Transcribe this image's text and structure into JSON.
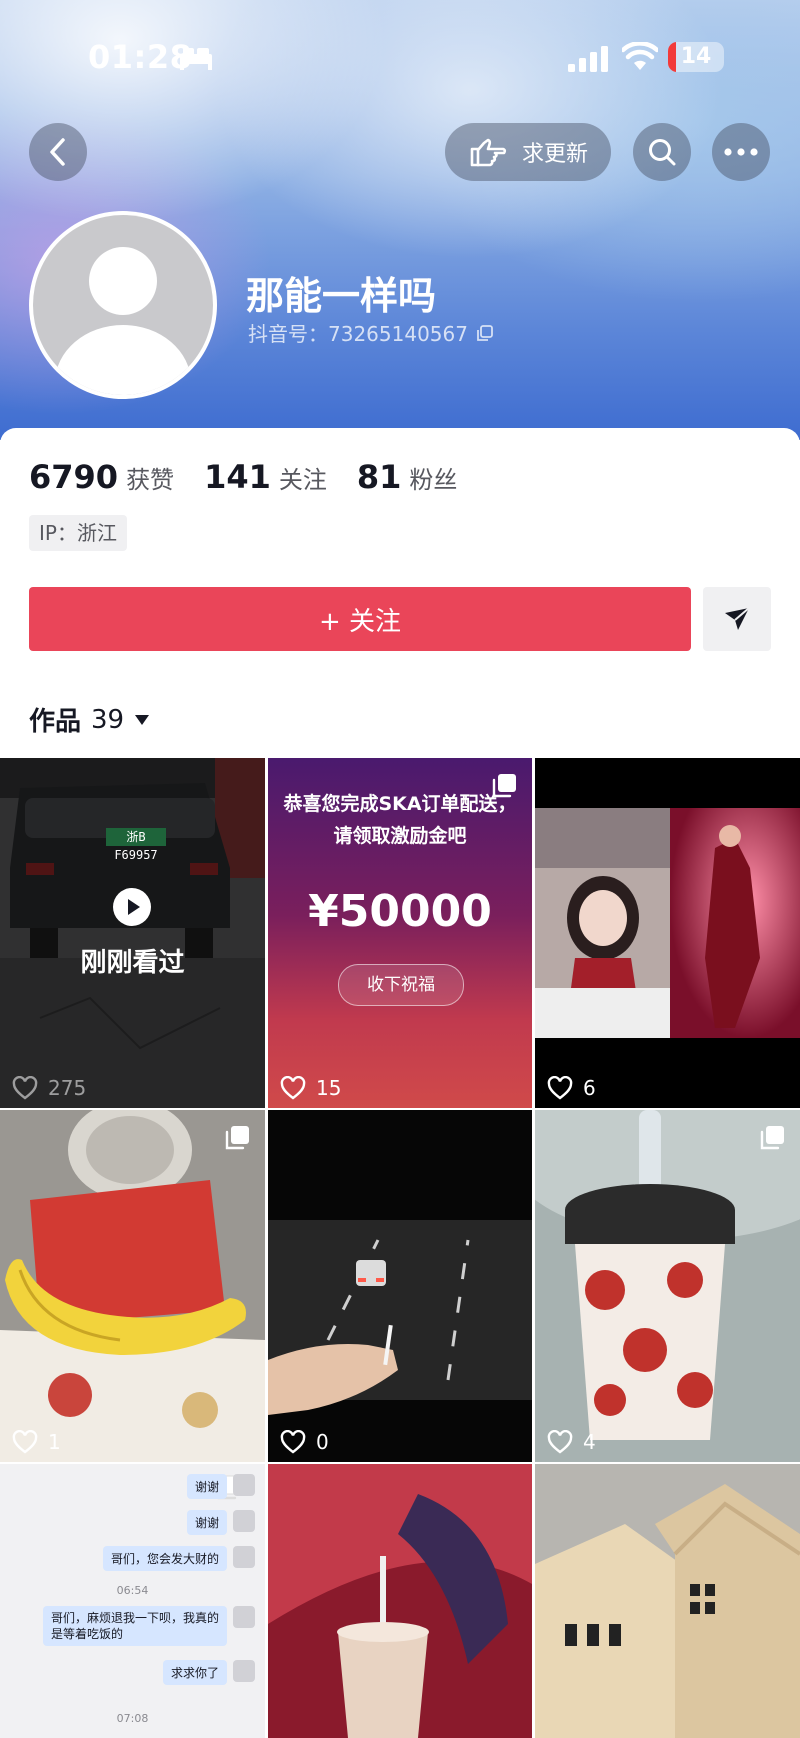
{
  "status_bar": {
    "time": "01:28",
    "battery": "14",
    "battery_level": 0.14
  },
  "header": {
    "request_update_label": "求更新",
    "nickname": "那能一样吗",
    "douyin_id": "抖音号：73265140567"
  },
  "stats": [
    {
      "value": "6790",
      "label": "获赞"
    },
    {
      "value": "141",
      "label": "关注"
    },
    {
      "value": "81",
      "label": "粉丝"
    }
  ],
  "ip_tag": "IP：浙江",
  "follow_button": "+ 关注",
  "works_tab": {
    "label": "作品",
    "count": "39"
  },
  "grid": {
    "tiles": [
      {
        "likes": "275",
        "overlay": "刚刚看过",
        "plate": "浙B F69957"
      },
      {
        "likes": "15",
        "headline": "恭喜您完成SKA订单配送，请领取激励金吧",
        "amount": "¥50000",
        "button": "收下祝福"
      },
      {
        "likes": "6"
      },
      {
        "likes": "1"
      },
      {
        "likes": "0"
      },
      {
        "likes": "4"
      },
      {
        "chat": [
          {
            "text": "谢谢"
          },
          {
            "text": "谢谢"
          },
          {
            "text": "哥们，您会发大财的"
          },
          {
            "time": "06:54"
          },
          {
            "text": "哥们，麻烦退我一下呗，我真的是等着吃饭的"
          },
          {
            "text": "求求你了"
          },
          {
            "time": "07:08"
          }
        ]
      },
      {},
      {}
    ]
  },
  "colors": {
    "accent": "#ea4559",
    "text": "#161823",
    "secondary": "#57585f"
  }
}
